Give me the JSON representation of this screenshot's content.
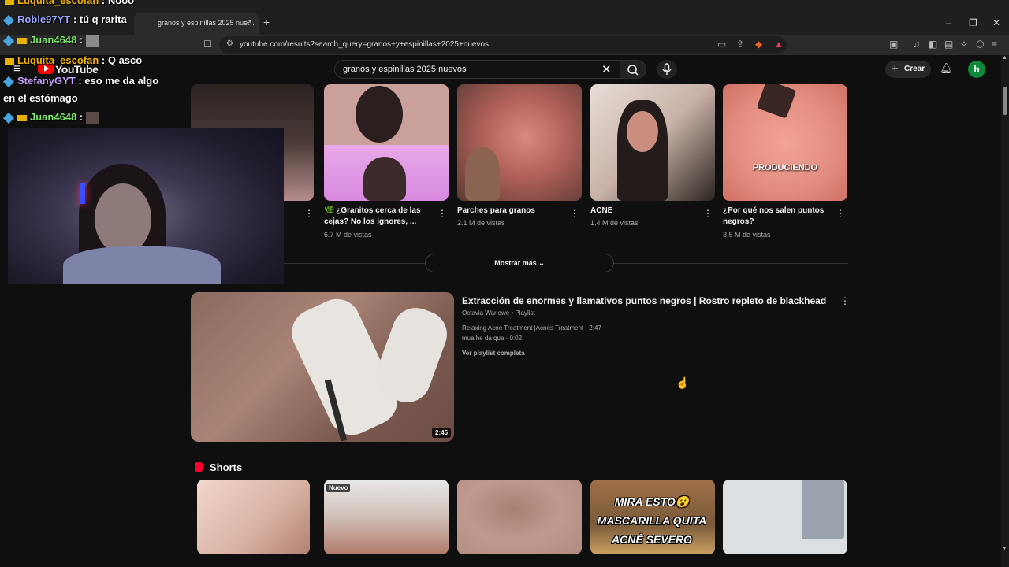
{
  "browser": {
    "tab_title": "granos y espinillas 2025 nue…",
    "tab_close": "×",
    "new_tab": "+",
    "url": "youtube.com/results?search_query=granos+y+espinillas+2025+nuevos",
    "window_controls": [
      "–",
      "❐",
      "✕"
    ]
  },
  "youtube": {
    "logo_text": "YouTube",
    "search_value": "granos y espinillas 2025 nuevos",
    "create_label": "Crear",
    "avatar_letter": "h"
  },
  "top_cards": [
    {
      "title": "",
      "views": ""
    },
    {
      "title": "🌿 ¿Granitos cerca de las cejas? No los ignores, ...",
      "views": "6.7 M de vistas"
    },
    {
      "title": "Parches para granos",
      "views": "2.1 M de vistas"
    },
    {
      "title": "ACNÉ",
      "views": "1.4 M de vistas"
    },
    {
      "title": "¿Por qué nos salen puntos negros?",
      "views": "3.5 M de vistas"
    }
  ],
  "thumb_overlay": "PRODUCIENDO",
  "show_more": "Mostrar más",
  "playlist": {
    "title": "Extracción de enormes y llamativos puntos negros | Rostro repleto de blackhead",
    "meta": "Octavia Warlowe • Playlist",
    "items": [
      "Relaxing Acne Treatment |Acnes Treatment · 2:47",
      "mua he da qua · 0:02"
    ],
    "view_full": "Ver playlist completa",
    "duration": "2:45"
  },
  "shorts": {
    "heading": "Shorts",
    "new_badge": "Nuevo",
    "overlay_lines": [
      "MIRA ESTO😮",
      "MASCARILLA QUITA",
      "ACNÉ SEVERO"
    ]
  },
  "stream_chat": [
    {
      "name": "Luquita_escofan",
      "text": ": Nooo"
    },
    {
      "name": "Roble97YT",
      "text": ": tú q rarita"
    },
    {
      "name": "Juan4648",
      "text": ":"
    },
    {
      "name": "Luquita_escofan",
      "text": ": Q asco"
    },
    {
      "name": "StefanyGYT",
      "text": ": eso me da algo"
    },
    {
      "name": "",
      "text": "en el estómago"
    },
    {
      "name": "Juan4648",
      "text": ":"
    }
  ],
  "colors": {
    "background": "#0f0f0f",
    "youtube_red": "#ff0000",
    "avatar_green": "#0f8a3c"
  }
}
